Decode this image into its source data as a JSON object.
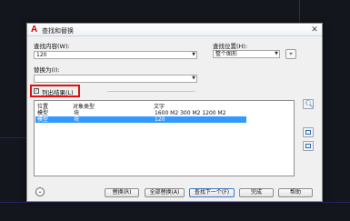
{
  "dialog": {
    "title": "查找和替换",
    "close_glyph": "✕"
  },
  "find": {
    "label": "查找内容(W):",
    "value": "120"
  },
  "location": {
    "label": "查找位置(H):",
    "value": "整个图形"
  },
  "replace": {
    "label": "替换为(I):",
    "value": ""
  },
  "list_results": {
    "label": "列出结果(L)",
    "checked": true
  },
  "results": {
    "columns": [
      "位置",
      "对象类型",
      "文字"
    ],
    "rows": [
      {
        "location": "模型",
        "type": "块",
        "text": "1600 M2   300 M2 1200 M2"
      },
      {
        "location": "模型",
        "type": "块",
        "text": "120",
        "selected": true
      }
    ]
  },
  "buttons": {
    "replace": "替换(R)",
    "replace_all": "全部替换(A)",
    "find_next": "查找下一个(F)",
    "done": "完成",
    "help": "帮助"
  },
  "icons": {
    "app": "autocad-logo-icon",
    "select": "select-objects-icon",
    "zoom": "zoom-to-icon",
    "export": "export-report-icon",
    "expand": "expand-options-icon"
  },
  "colors": {
    "selection": "#3399ff",
    "highlight": "#e01010"
  }
}
